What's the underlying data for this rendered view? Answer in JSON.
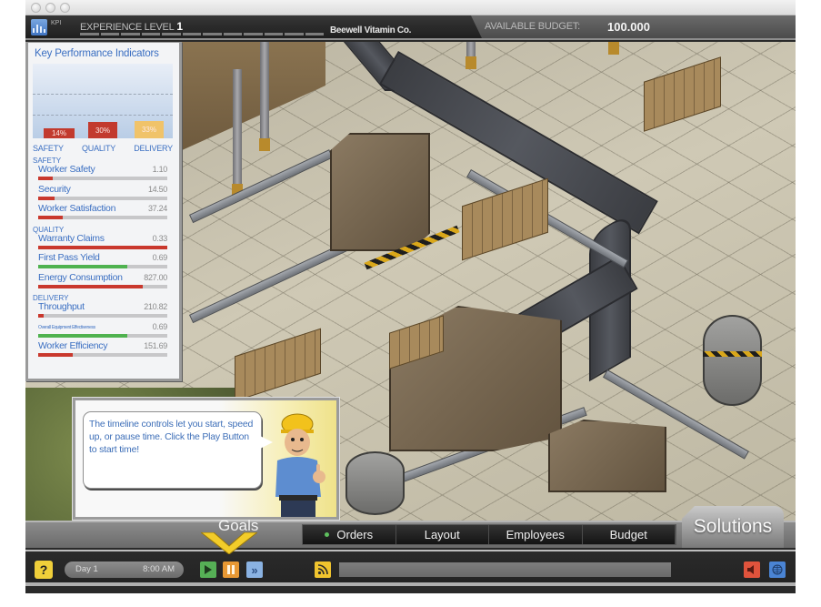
{
  "window": {
    "controls": [
      "close",
      "minimize",
      "zoom"
    ]
  },
  "hud": {
    "kpi_label": "KPI",
    "experience_label": "EXPERIENCE LEVEL",
    "experience_level": "1",
    "experience_progress_segments": 12,
    "experience_progress_filled": 0,
    "company": "Beewell Vitamin Co.",
    "budget_label": "AVAILABLE BUDGET:",
    "budget_value": "100.000"
  },
  "kpi": {
    "title": "Key Performance Indicators",
    "chart_data": {
      "type": "bar",
      "categories": [
        "SAFETY",
        "QUALITY",
        "DELIVERY"
      ],
      "values": [
        14,
        30,
        33
      ],
      "value_labels": [
        "14%",
        "30%",
        "33%"
      ],
      "colors": [
        "#c23a2e",
        "#c23a2e",
        "#f0c36a"
      ],
      "ylim": [
        0,
        100
      ],
      "grid": true,
      "title": "Key Performance Indicators"
    },
    "sections": [
      {
        "label": "SAFETY",
        "metrics": [
          {
            "name": "Worker Safety",
            "value": "1.10",
            "progress": 0.11,
            "color": "#c9382d"
          },
          {
            "name": "Security",
            "value": "14.50",
            "progress": 0.13,
            "color": "#c9382d"
          },
          {
            "name": "Worker Satisfaction",
            "value": "37.24",
            "progress": 0.19,
            "color": "#c9382d"
          }
        ]
      },
      {
        "label": "QUALITY",
        "metrics": [
          {
            "name": "Warranty Claims",
            "value": "0.33",
            "progress": 1.0,
            "color": "#c9382d"
          },
          {
            "name": "First Pass Yield",
            "value": "0.69",
            "progress": 0.69,
            "color": "#4fb24f"
          },
          {
            "name": "Energy Consumption",
            "value": "827.00",
            "progress": 0.81,
            "color": "#c9382d"
          }
        ]
      },
      {
        "label": "DELIVERY",
        "metrics": [
          {
            "name": "Throughput",
            "value": "210.82",
            "progress": 0.04,
            "color": "#c9382d"
          },
          {
            "name": "Overall Equipment Effectiveness",
            "value": "0.69",
            "progress": 0.69,
            "color": "#4fb24f",
            "small": true
          },
          {
            "name": "Worker Efficiency",
            "value": "151.69",
            "progress": 0.27,
            "color": "#c9382d"
          }
        ]
      }
    ]
  },
  "tip": {
    "text": "The timeline controls let you start, speed up, or pause time. Click the Play Button to start time!"
  },
  "nav": {
    "goals": "Goals",
    "tabs": [
      {
        "label": "Orders",
        "active": true
      },
      {
        "label": "Layout",
        "active": false
      },
      {
        "label": "Employees",
        "active": false
      },
      {
        "label": "Budget",
        "active": false
      }
    ],
    "solutions": "Solutions"
  },
  "controls": {
    "help": "?",
    "day": "Day 1",
    "time": "8:00 AM",
    "fast_forward": "»"
  }
}
